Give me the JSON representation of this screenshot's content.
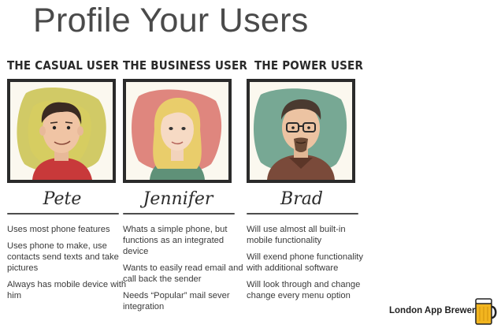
{
  "page": {
    "title": "Profile Your Users"
  },
  "personas": [
    {
      "heading": "THE CASUAL USER",
      "name": "Pete",
      "points": [
        "Uses most phone features",
        "Uses phone to make, use contacts send texts and take pictures",
        "Always has mobile device with him"
      ]
    },
    {
      "heading": "THE BUSINESS USER",
      "name": "Jennifer",
      "points": [
        "Whats a simple phone, but functions as an integrated device",
        "Wants to easily read email and call back the sender",
        "Needs “Popular” mail sever integration"
      ]
    },
    {
      "heading": "THE POWER USER",
      "name": "Brad",
      "points": [
        "Will use almost all built-in mobile functionality",
        "Will exend phone functionality with additional software",
        "Will look through and change change every menu option"
      ]
    }
  ],
  "brand": {
    "name": "London App Brewery",
    "icon": "beer-mug-icon"
  },
  "colors": {
    "casual_bg": "#c9c24e",
    "business_bg": "#d9726a",
    "power_bg": "#5f9a84",
    "logo_amber": "#f2b51f"
  }
}
